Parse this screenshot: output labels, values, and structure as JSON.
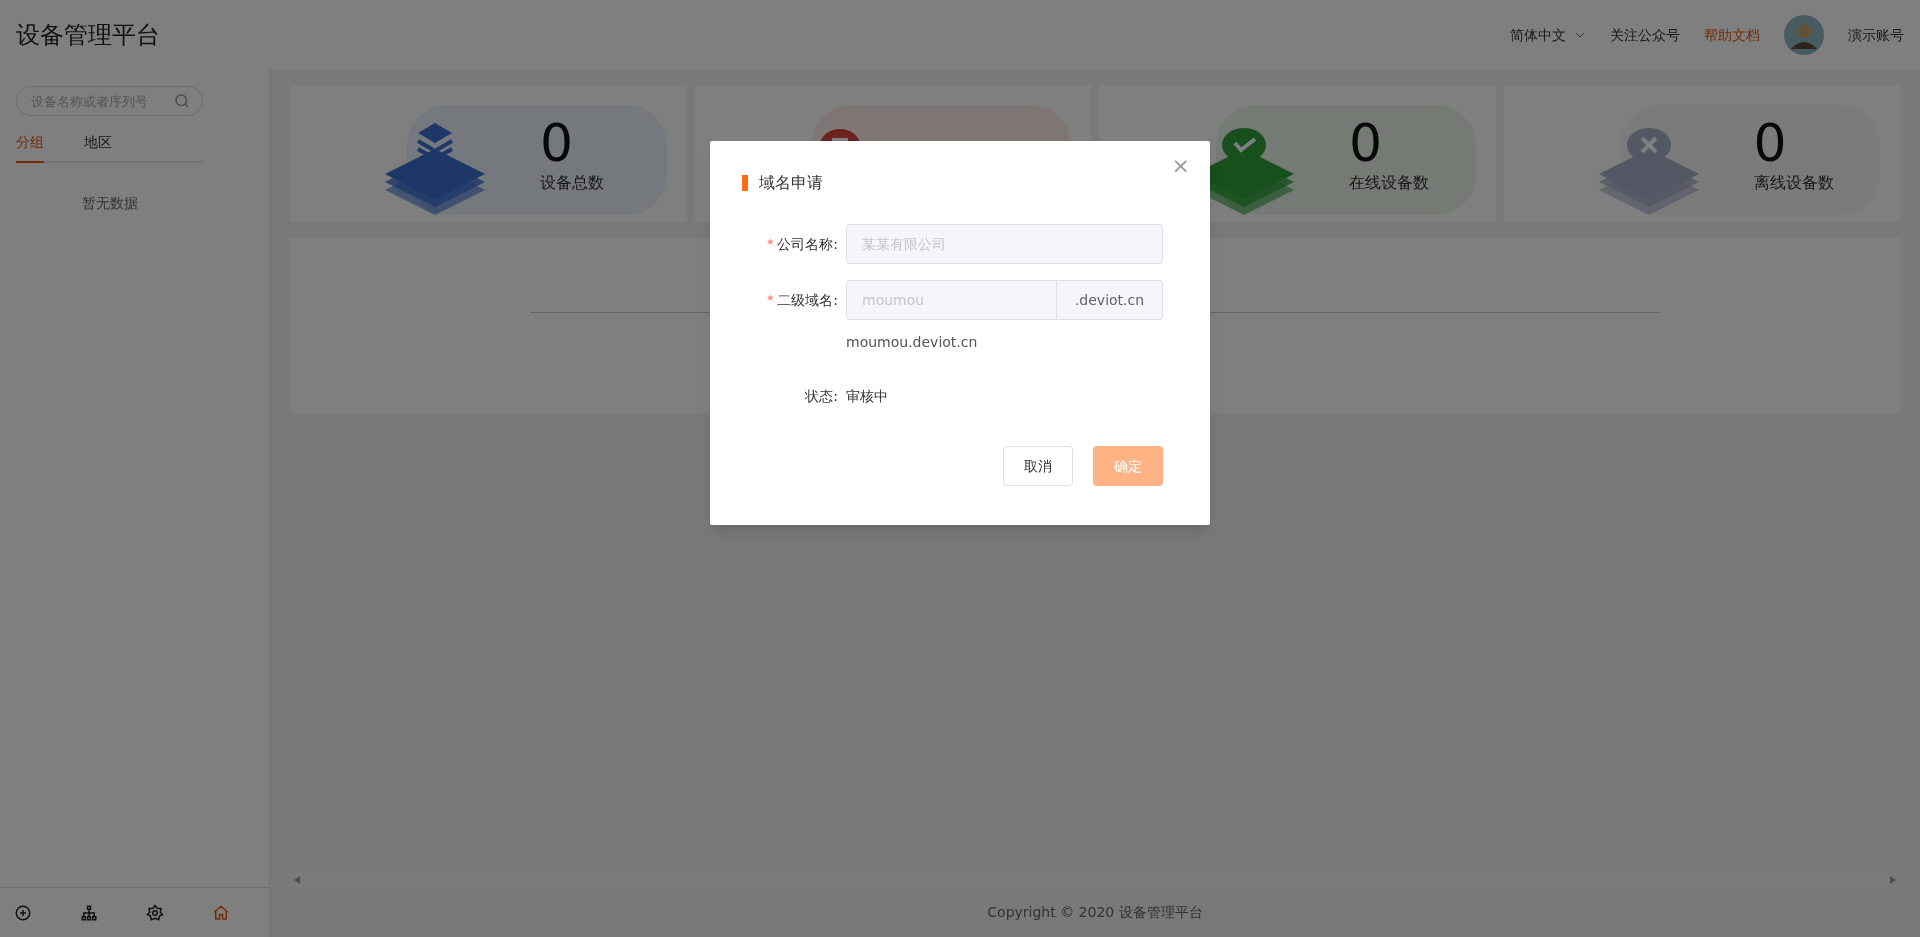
{
  "header": {
    "title": "设备管理平台",
    "language": "简体中文",
    "links": [
      {
        "label": "关注公众号",
        "highlighted": false
      },
      {
        "label": "帮助文档",
        "highlighted": true
      }
    ],
    "account": "演示账号"
  },
  "sidebar": {
    "search": {
      "placeholder": "设备名称或者序列号"
    },
    "tabs": [
      {
        "label": "分组",
        "selected": true
      },
      {
        "label": "地区",
        "selected": false
      }
    ],
    "empty_text": "暂无数据",
    "bottom_icons": [
      {
        "kind": "add",
        "selected": false
      },
      {
        "kind": "tree",
        "selected": false
      },
      {
        "kind": "gear",
        "selected": false
      },
      {
        "kind": "home",
        "selected": true
      }
    ]
  },
  "stats": [
    {
      "kind": "layers",
      "value": "0",
      "label": "设备总数"
    },
    {
      "kind": "alarm"
    },
    {
      "kind": "check",
      "value": "0",
      "label": "在线设备数"
    },
    {
      "kind": "cross",
      "value": "0",
      "label": "离线设备数"
    }
  ],
  "footer": {
    "copyright": "Copyright © 2020 设备管理平台"
  },
  "dialog": {
    "title": "域名申请",
    "close": "×",
    "fields": [
      {
        "kind": "text",
        "required_mark": "*",
        "label": "公司名称:",
        "placeholder": "某某有限公司"
      },
      {
        "kind": "suffix",
        "required_mark": "*",
        "label": "二级域名:",
        "placeholder": "moumou",
        "suffix": ".deviot.cn"
      }
    ],
    "preview": "moumou.deviot.cn",
    "status": {
      "label": "状态:",
      "value": "审核中"
    },
    "buttons": [
      {
        "label": "取消",
        "primary": false
      },
      {
        "label": "确定",
        "primary": true
      }
    ]
  }
}
